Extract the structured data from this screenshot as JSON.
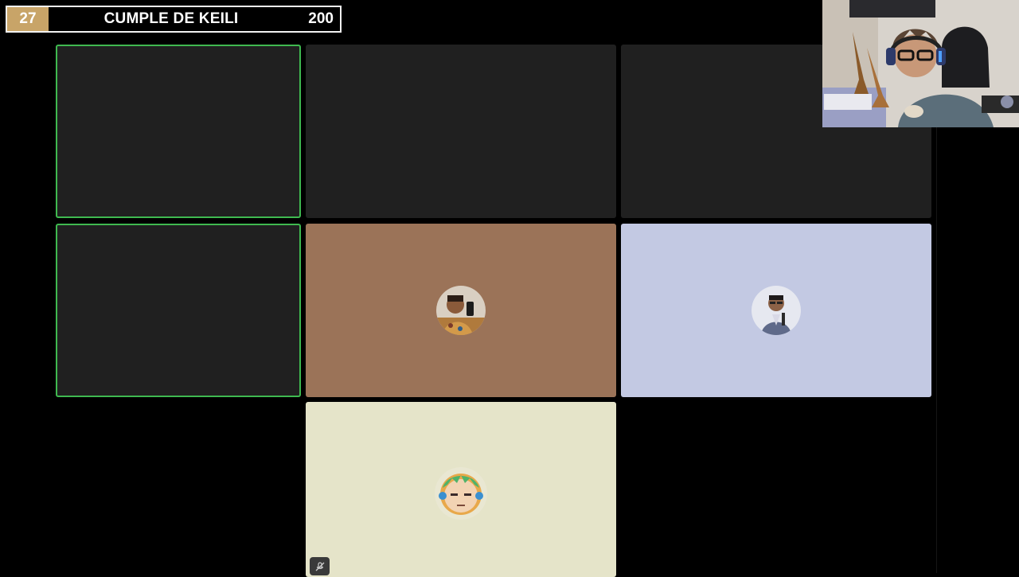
{
  "banner": {
    "count": "27",
    "title": "CUMPLE DE KEILI",
    "score": "200",
    "count_color": "#c8a468"
  },
  "gallery": {
    "tiles": [
      {
        "kind": "blank",
        "speaking": true
      },
      {
        "kind": "blank",
        "speaking": false
      },
      {
        "kind": "blank",
        "speaking": false
      },
      {
        "kind": "blank",
        "speaking": true
      },
      {
        "kind": "avatar",
        "avatar_icon": "participant-photo-icon",
        "background": "#9b7358"
      },
      {
        "kind": "avatar",
        "avatar_icon": "participant-photo-icon",
        "background": "#c3c9e3"
      },
      {
        "kind": "avatar",
        "avatar_icon": "anime-avatar-icon",
        "background": "#e5e4c9",
        "muted": true
      }
    ],
    "speaking_color": "#3fb950",
    "empty_tile_color": "#202020"
  },
  "webcam": {
    "icon": "streamer-webcam-icon"
  },
  "icons": {
    "muted": "mic-off-icon"
  }
}
